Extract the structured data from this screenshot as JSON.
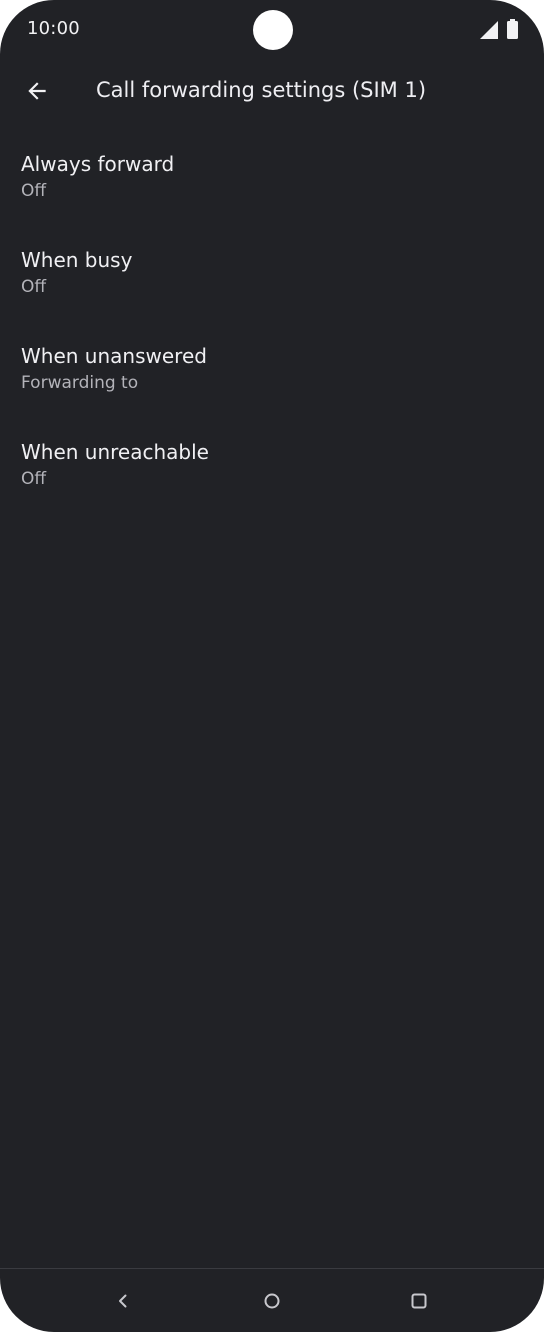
{
  "status_bar": {
    "time": "10:00"
  },
  "icons": {
    "signal": "cellular-signal-icon",
    "battery": "battery-icon",
    "back": "arrow-back-icon",
    "nav_back": "nav-back-icon",
    "nav_home": "nav-home-icon",
    "nav_recents": "nav-recents-icon"
  },
  "colors": {
    "background": "#212226",
    "text_primary": "#f0f0f3",
    "text_secondary": "#b3b3b9"
  },
  "header": {
    "title": "Call forwarding settings (SIM 1)"
  },
  "settings": {
    "items": [
      {
        "title": "Always forward",
        "summary": "Off"
      },
      {
        "title": "When busy",
        "summary": "Off"
      },
      {
        "title": "When unanswered",
        "summary": "Forwarding to"
      },
      {
        "title": "When unreachable",
        "summary": "Off"
      }
    ]
  }
}
